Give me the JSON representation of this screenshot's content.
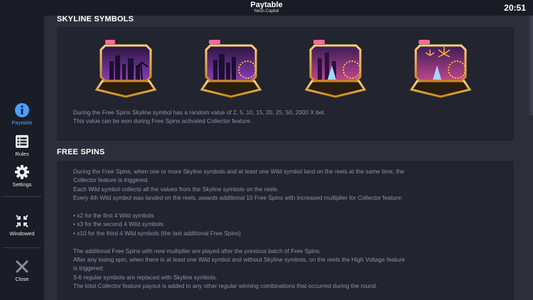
{
  "header": {
    "title": "Paytable",
    "subtitle": "Neon Capital",
    "clock": "20:51"
  },
  "sidebar": {
    "paytable": "Paytable",
    "rules": "Rules",
    "settings": "Settings",
    "windowed": "Windowed",
    "close": "Close"
  },
  "skyline": {
    "title": "SKYLINE SYMBOLS",
    "symbols": [
      "skyline-symbol-1",
      "skyline-symbol-2",
      "skyline-symbol-3",
      "skyline-symbol-4"
    ],
    "line1": "During the Free Spins Skyline symbol has a random value of 2, 5, 10, 15, 20, 25, 50, 2000 X bet.",
    "line2": "This value can be won during Free Spins activated Collector feature."
  },
  "freespins": {
    "title": "FREE SPINS",
    "l1": "During the Free Spins, when one or more Skyline symbols and at least one Wild symbol land on the reels at the same time, the",
    "l2": "Collector feature is triggered.",
    "l3": "Each Wild symbol collects all the values from the Skyline symbols on the reels.",
    "l4": "Every 4th Wild symbol was landed on the reels, awards additional 10 Free Spins with increased multiplier for Collector feature:",
    "b1": "• x2 for the first 4 Wild symbols",
    "b2": "• x3 for the second 4 Wild symbols",
    "b3": "• x10 for the third 4 Wild symbols (the last additional Free Spins)",
    "l5": "The additional Free Spins with new multiplier are played after the previous batch of Free Spins.",
    "l6": "After any losing spin, when there is at least one Wild symbol and without Skyline symbols, on the reels the High Voltage feature",
    "l7": "is triggered:",
    "l8": "3-6 regular symbols are replaced with Skyline symbols.",
    "l9": "The total Collector feature payout is added to any other regular winning combinations that occurred during the round."
  }
}
